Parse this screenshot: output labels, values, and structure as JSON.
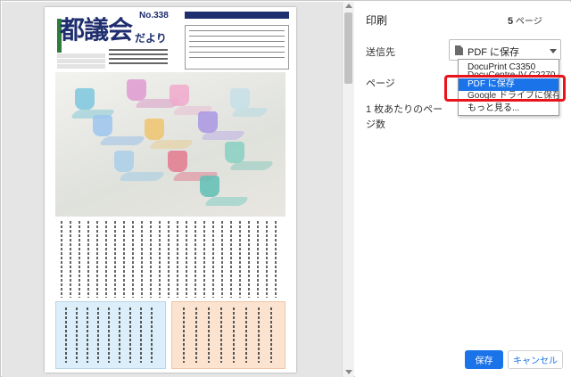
{
  "preview": {
    "newsletter_title": "都議会",
    "newsletter_title_suffix": "だより",
    "issue_number": "No.338"
  },
  "settings": {
    "title": "印刷",
    "page_count": "5",
    "page_count_suffix": "ページ",
    "destination_label": "送信先",
    "destination_value": "PDF に保存",
    "pages_label": "ページ",
    "pages_per_sheet_label": "1 枚あたりのページ数",
    "destination_options": [
      "DocuPrint C3350",
      "DocuCentre-IV C2270 (1)",
      "PDF に保存",
      "Google ドライブに保存",
      "もっと見る..."
    ],
    "selected_option_index": 2
  },
  "buttons": {
    "save": "保存",
    "cancel": "キャンセル"
  },
  "colors": {
    "accent": "#1a73e8",
    "highlight_box": "#e8141a",
    "newsletter_navy": "#1f2e6e"
  },
  "icons": [
    "pdf-document-icon",
    "chevron-down-icon",
    "scroll-up-arrow-icon",
    "scroll-down-arrow-icon"
  ]
}
